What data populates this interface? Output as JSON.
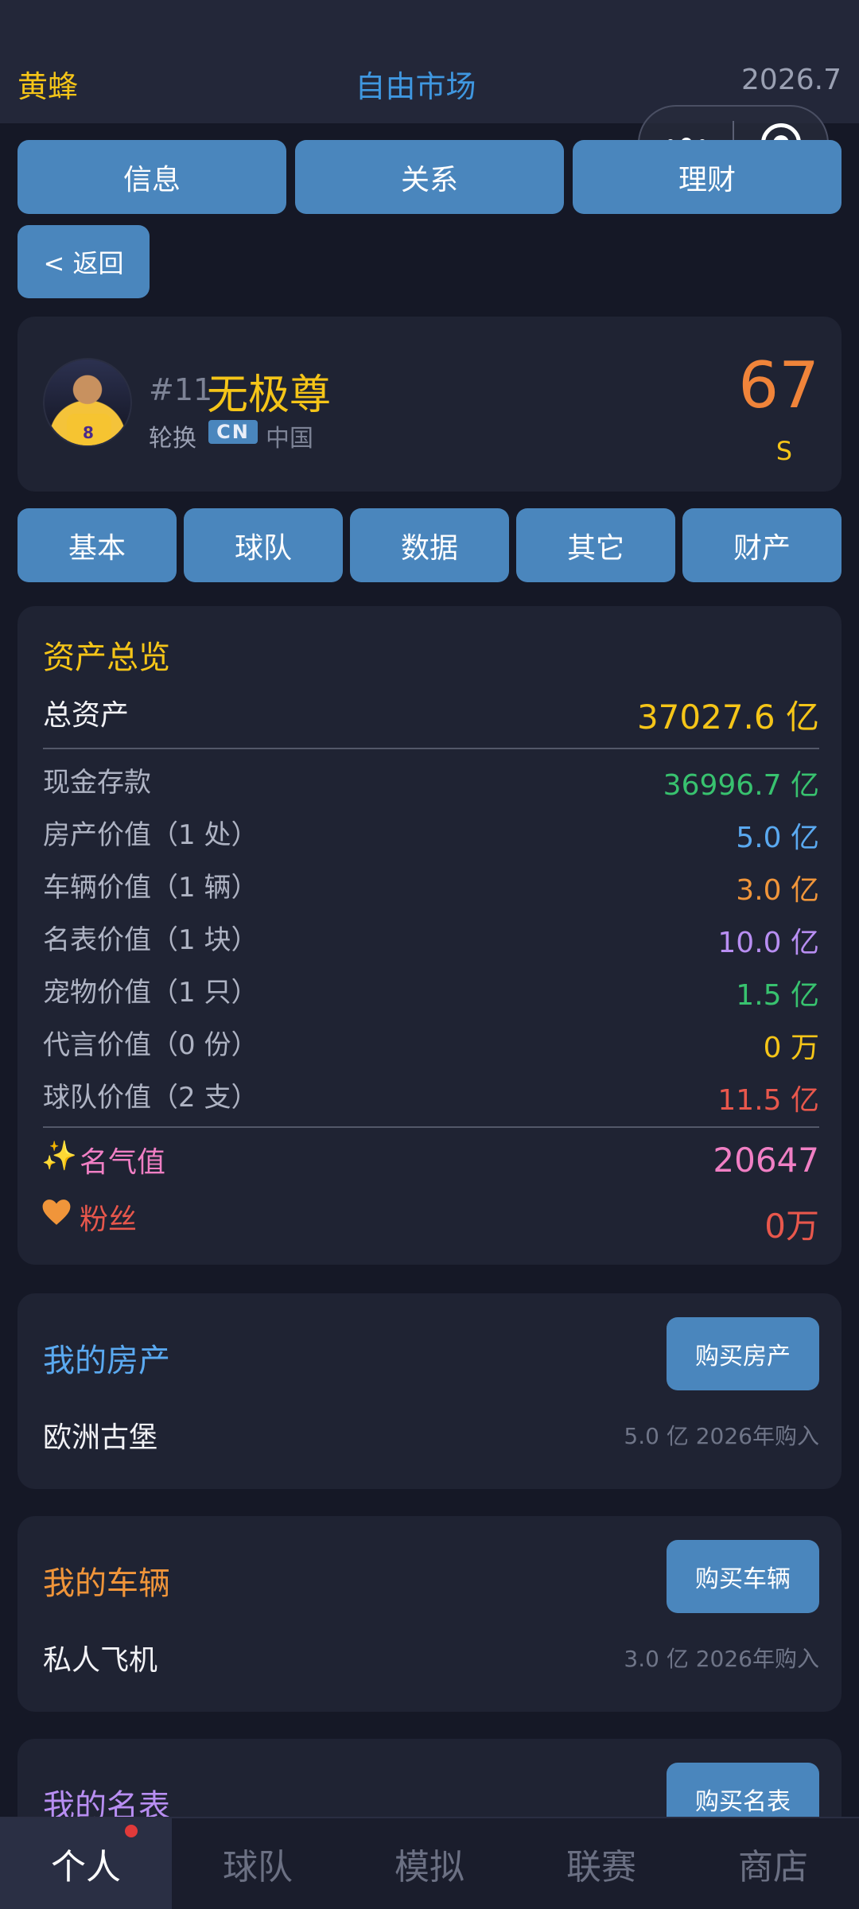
{
  "header": {
    "team": "黄蜂",
    "market": "自由市场",
    "date": "2026.7"
  },
  "top_tabs": [
    "信息",
    "关系",
    "理财"
  ],
  "back_label": "< 返回",
  "player": {
    "number": "#11",
    "name": "无极尊",
    "position": "轮换",
    "flag_code": "CN",
    "country": "中国",
    "rating": "67",
    "grade": "S",
    "jersey_number": "8"
  },
  "sub_tabs": [
    "基本",
    "球队",
    "数据",
    "其它",
    "财产"
  ],
  "assets": {
    "title": "资产总览",
    "total_label": "总资产",
    "total_value": "37027.6 亿",
    "rows": [
      {
        "label": "现金存款",
        "value": "36996.7 亿",
        "color": "#38c26f"
      },
      {
        "label": "房产价值（1 处）",
        "value": "5.0 亿",
        "color": "#5aa9f0"
      },
      {
        "label": "车辆价值（1 辆）",
        "value": "3.0 亿",
        "color": "#f0953a"
      },
      {
        "label": "名表价值（1 块）",
        "value": "10.0 亿",
        "color": "#b88ef2"
      },
      {
        "label": "宠物价值（1 只）",
        "value": "1.5 亿",
        "color": "#38c26f"
      },
      {
        "label": "代言价值（0 份）",
        "value": "0 万",
        "color": "#f5c518"
      },
      {
        "label": "球队价值（2 支）",
        "value": "11.5 亿",
        "color": "#e8574c"
      }
    ],
    "fame_icon": "✨",
    "fame_label": "名气值",
    "fame_value": "20647",
    "fans_label": "粉丝",
    "fans_value": "0万"
  },
  "property": {
    "title": "我的房产",
    "button": "购买房产",
    "item_name": "欧洲古堡",
    "item_meta": "5.0 亿  2026年购入"
  },
  "vehicle": {
    "title": "我的车辆",
    "button": "购买车辆",
    "item_name": "私人飞机",
    "item_meta": "3.0 亿  2026年购入"
  },
  "watch": {
    "title": "我的名表",
    "button": "购买名表"
  },
  "bottom_tabs": [
    "个人",
    "球队",
    "模拟",
    "联赛",
    "商店"
  ],
  "colors": {
    "accent_blue": "#4a86bd",
    "gold": "#f5c518",
    "background": "#151826",
    "card": "#1f2333"
  }
}
